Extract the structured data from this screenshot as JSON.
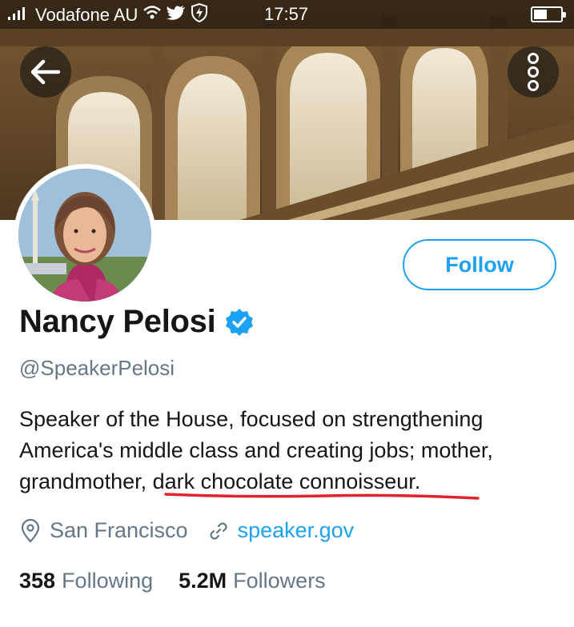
{
  "status_bar": {
    "carrier": "Vodafone AU",
    "time": "17:57"
  },
  "header": {
    "back_icon": "arrow-left-icon",
    "more_icon": "more-vertical-icon"
  },
  "profile": {
    "display_name": "Nancy Pelosi",
    "verified": true,
    "handle": "@SpeakerPelosi",
    "bio_part1": "Speaker of the House, focused on strengthening America's middle class and creating jobs; mother, grandmother, ",
    "bio_part2": "dark chocolate connoisseur.",
    "location": "San Francisco",
    "website": "speaker.gov",
    "follow_label": "Follow"
  },
  "stats": {
    "following_count": "358",
    "following_label": "Following",
    "followers_count": "5.2M",
    "followers_label": "Followers"
  },
  "colors": {
    "accent": "#1da1f2",
    "secondary_text": "#657786",
    "annotation": "#e0242b"
  }
}
